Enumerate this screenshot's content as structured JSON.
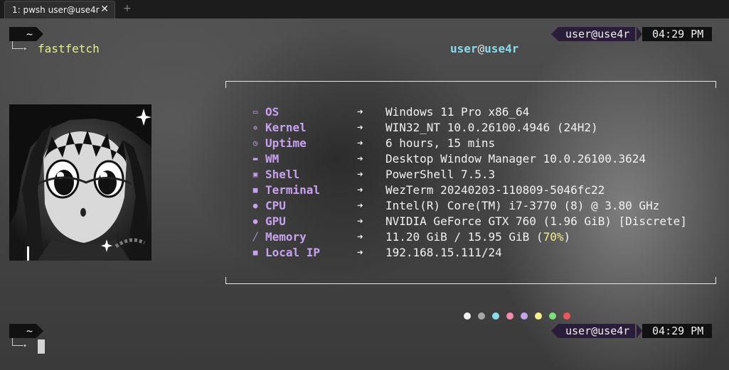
{
  "tabbar": {
    "tab_title": "1: pwsh user@use4r",
    "close_glyph": "✕",
    "new_tab_glyph": "+"
  },
  "prompt": {
    "path": "~",
    "user_host": "user@use4r",
    "time": "04:29 PM",
    "command": "fastfetch"
  },
  "fetch": {
    "header_user": "user",
    "header_at": "@",
    "header_host": "use4r",
    "rows": [
      {
        "icon": "monitor-icon",
        "glyph": "▭",
        "key": "OS",
        "value": "Windows 11 Pro x86_64"
      },
      {
        "icon": "gear-icon",
        "glyph": "✲",
        "key": "Kernel",
        "value": "WIN32_NT 10.0.26100.4946 (24H2)"
      },
      {
        "icon": "clock-icon",
        "glyph": "◷",
        "key": "Uptime",
        "value": "6 hours, 15 mins"
      },
      {
        "icon": "window-icon",
        "glyph": "▬",
        "key": "WM",
        "value": "Desktop Window Manager 10.0.26100.3624"
      },
      {
        "icon": "shell-icon",
        "glyph": "▣",
        "key": "Shell",
        "value": "PowerShell 7.5.3"
      },
      {
        "icon": "terminal-icon",
        "glyph": "■",
        "key": "Terminal",
        "value": "WezTerm 20240203-110809-5046fc22"
      },
      {
        "icon": "cpu-icon",
        "glyph": "●",
        "key": "CPU",
        "value": "Intel(R) Core(TM) i7-3770 (8) @ 3.80 GHz"
      },
      {
        "icon": "gpu-icon",
        "glyph": "●",
        "key": "GPU",
        "value": "NVIDIA GeForce GTX 760 (1.96 GiB) [Discrete]"
      },
      {
        "icon": "memory-icon",
        "glyph": "╱",
        "key": "Memory",
        "value": "11.20 GiB / 15.95 GiB ("
      },
      {
        "icon": "network-icon",
        "glyph": "■",
        "key": "Local IP",
        "value": "192.168.15.111/24"
      }
    ],
    "arrow": "➜",
    "memory_percent": "70%",
    "memory_close": ")",
    "palette": [
      "#f2f2f2",
      "#a6a6a6",
      "#89dceb",
      "#f38ba8",
      "#c8a2f0",
      "#f5f08a",
      "#79e07a",
      "#f0555f"
    ]
  }
}
